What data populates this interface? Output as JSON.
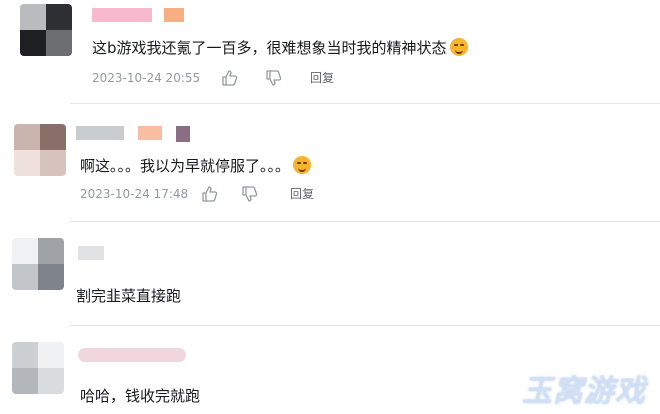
{
  "comments": [
    {
      "text": "这b游戏我还氪了一百多，很难想象当时我的精神状态",
      "emoji": "dizzy-face-emoji",
      "time": "2023-10-24 20:55",
      "reply_label": "回复"
    },
    {
      "text": "啊这。。。我以为早就停服了。。。",
      "emoji": "crying-laugh-emoji",
      "time": "2023-10-24 17:48",
      "reply_label": "回复"
    },
    {
      "text": "割完韭菜直接跑"
    },
    {
      "text": "哈哈，钱收完就跑"
    }
  ],
  "watermark": "玉窝游戏",
  "colors": {
    "text": "#18191c",
    "meta": "#9499a0",
    "divider": "#e3e5e7"
  }
}
